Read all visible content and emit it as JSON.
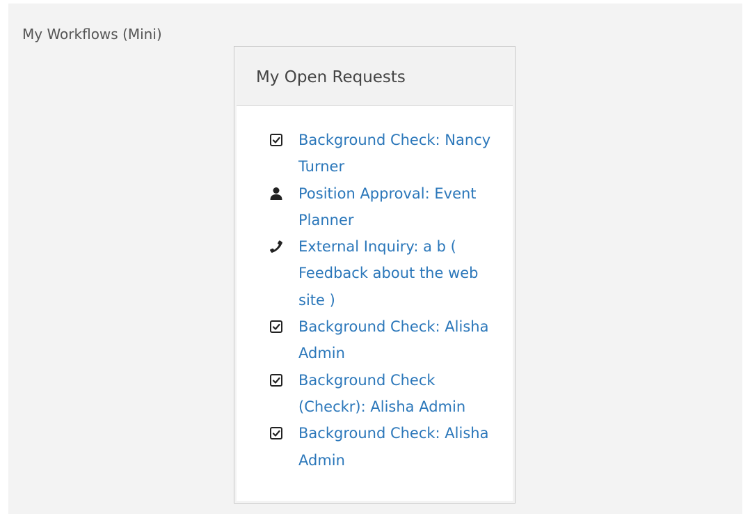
{
  "block": {
    "title": "My Workflows (Mini)"
  },
  "panel": {
    "title": "My Open Requests"
  },
  "items": [
    {
      "icon": "check-square-icon",
      "label": "Background Check: Nancy Turner"
    },
    {
      "icon": "user-icon",
      "label": "Position Approval: Event Planner"
    },
    {
      "icon": "phone-icon",
      "label": "External Inquiry: a b ( Feedback about the web site )"
    },
    {
      "icon": "check-square-icon",
      "label": "Background Check: Alisha Admin"
    },
    {
      "icon": "check-square-icon",
      "label": "Background Check (Checkr): Alisha Admin"
    },
    {
      "icon": "check-square-icon",
      "label": "Background Check: Alisha Admin"
    }
  ],
  "colors": {
    "link": "#2b77ba",
    "icon": "#222222",
    "background": "#f3f3f3",
    "panel_heading": "#f2f2f2"
  }
}
